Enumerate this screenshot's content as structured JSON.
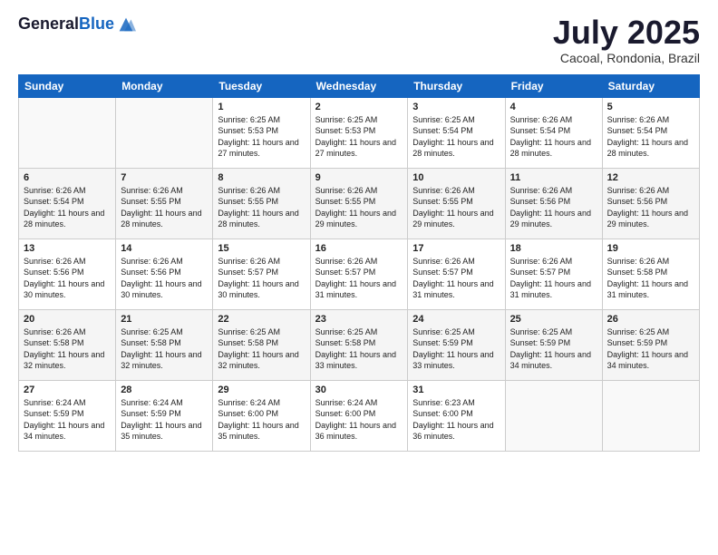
{
  "logo": {
    "general": "General",
    "blue": "Blue"
  },
  "header": {
    "month": "July 2025",
    "location": "Cacoal, Rondonia, Brazil"
  },
  "weekdays": [
    "Sunday",
    "Monday",
    "Tuesday",
    "Wednesday",
    "Thursday",
    "Friday",
    "Saturday"
  ],
  "weeks": [
    [
      {
        "day": "",
        "sunrise": "",
        "sunset": "",
        "daylight": ""
      },
      {
        "day": "",
        "sunrise": "",
        "sunset": "",
        "daylight": ""
      },
      {
        "day": "1",
        "sunrise": "Sunrise: 6:25 AM",
        "sunset": "Sunset: 5:53 PM",
        "daylight": "Daylight: 11 hours and 27 minutes."
      },
      {
        "day": "2",
        "sunrise": "Sunrise: 6:25 AM",
        "sunset": "Sunset: 5:53 PM",
        "daylight": "Daylight: 11 hours and 27 minutes."
      },
      {
        "day": "3",
        "sunrise": "Sunrise: 6:25 AM",
        "sunset": "Sunset: 5:54 PM",
        "daylight": "Daylight: 11 hours and 28 minutes."
      },
      {
        "day": "4",
        "sunrise": "Sunrise: 6:26 AM",
        "sunset": "Sunset: 5:54 PM",
        "daylight": "Daylight: 11 hours and 28 minutes."
      },
      {
        "day": "5",
        "sunrise": "Sunrise: 6:26 AM",
        "sunset": "Sunset: 5:54 PM",
        "daylight": "Daylight: 11 hours and 28 minutes."
      }
    ],
    [
      {
        "day": "6",
        "sunrise": "Sunrise: 6:26 AM",
        "sunset": "Sunset: 5:54 PM",
        "daylight": "Daylight: 11 hours and 28 minutes."
      },
      {
        "day": "7",
        "sunrise": "Sunrise: 6:26 AM",
        "sunset": "Sunset: 5:55 PM",
        "daylight": "Daylight: 11 hours and 28 minutes."
      },
      {
        "day": "8",
        "sunrise": "Sunrise: 6:26 AM",
        "sunset": "Sunset: 5:55 PM",
        "daylight": "Daylight: 11 hours and 28 minutes."
      },
      {
        "day": "9",
        "sunrise": "Sunrise: 6:26 AM",
        "sunset": "Sunset: 5:55 PM",
        "daylight": "Daylight: 11 hours and 29 minutes."
      },
      {
        "day": "10",
        "sunrise": "Sunrise: 6:26 AM",
        "sunset": "Sunset: 5:55 PM",
        "daylight": "Daylight: 11 hours and 29 minutes."
      },
      {
        "day": "11",
        "sunrise": "Sunrise: 6:26 AM",
        "sunset": "Sunset: 5:56 PM",
        "daylight": "Daylight: 11 hours and 29 minutes."
      },
      {
        "day": "12",
        "sunrise": "Sunrise: 6:26 AM",
        "sunset": "Sunset: 5:56 PM",
        "daylight": "Daylight: 11 hours and 29 minutes."
      }
    ],
    [
      {
        "day": "13",
        "sunrise": "Sunrise: 6:26 AM",
        "sunset": "Sunset: 5:56 PM",
        "daylight": "Daylight: 11 hours and 30 minutes."
      },
      {
        "day": "14",
        "sunrise": "Sunrise: 6:26 AM",
        "sunset": "Sunset: 5:56 PM",
        "daylight": "Daylight: 11 hours and 30 minutes."
      },
      {
        "day": "15",
        "sunrise": "Sunrise: 6:26 AM",
        "sunset": "Sunset: 5:57 PM",
        "daylight": "Daylight: 11 hours and 30 minutes."
      },
      {
        "day": "16",
        "sunrise": "Sunrise: 6:26 AM",
        "sunset": "Sunset: 5:57 PM",
        "daylight": "Daylight: 11 hours and 31 minutes."
      },
      {
        "day": "17",
        "sunrise": "Sunrise: 6:26 AM",
        "sunset": "Sunset: 5:57 PM",
        "daylight": "Daylight: 11 hours and 31 minutes."
      },
      {
        "day": "18",
        "sunrise": "Sunrise: 6:26 AM",
        "sunset": "Sunset: 5:57 PM",
        "daylight": "Daylight: 11 hours and 31 minutes."
      },
      {
        "day": "19",
        "sunrise": "Sunrise: 6:26 AM",
        "sunset": "Sunset: 5:58 PM",
        "daylight": "Daylight: 11 hours and 31 minutes."
      }
    ],
    [
      {
        "day": "20",
        "sunrise": "Sunrise: 6:26 AM",
        "sunset": "Sunset: 5:58 PM",
        "daylight": "Daylight: 11 hours and 32 minutes."
      },
      {
        "day": "21",
        "sunrise": "Sunrise: 6:25 AM",
        "sunset": "Sunset: 5:58 PM",
        "daylight": "Daylight: 11 hours and 32 minutes."
      },
      {
        "day": "22",
        "sunrise": "Sunrise: 6:25 AM",
        "sunset": "Sunset: 5:58 PM",
        "daylight": "Daylight: 11 hours and 32 minutes."
      },
      {
        "day": "23",
        "sunrise": "Sunrise: 6:25 AM",
        "sunset": "Sunset: 5:58 PM",
        "daylight": "Daylight: 11 hours and 33 minutes."
      },
      {
        "day": "24",
        "sunrise": "Sunrise: 6:25 AM",
        "sunset": "Sunset: 5:59 PM",
        "daylight": "Daylight: 11 hours and 33 minutes."
      },
      {
        "day": "25",
        "sunrise": "Sunrise: 6:25 AM",
        "sunset": "Sunset: 5:59 PM",
        "daylight": "Daylight: 11 hours and 34 minutes."
      },
      {
        "day": "26",
        "sunrise": "Sunrise: 6:25 AM",
        "sunset": "Sunset: 5:59 PM",
        "daylight": "Daylight: 11 hours and 34 minutes."
      }
    ],
    [
      {
        "day": "27",
        "sunrise": "Sunrise: 6:24 AM",
        "sunset": "Sunset: 5:59 PM",
        "daylight": "Daylight: 11 hours and 34 minutes."
      },
      {
        "day": "28",
        "sunrise": "Sunrise: 6:24 AM",
        "sunset": "Sunset: 5:59 PM",
        "daylight": "Daylight: 11 hours and 35 minutes."
      },
      {
        "day": "29",
        "sunrise": "Sunrise: 6:24 AM",
        "sunset": "Sunset: 6:00 PM",
        "daylight": "Daylight: 11 hours and 35 minutes."
      },
      {
        "day": "30",
        "sunrise": "Sunrise: 6:24 AM",
        "sunset": "Sunset: 6:00 PM",
        "daylight": "Daylight: 11 hours and 36 minutes."
      },
      {
        "day": "31",
        "sunrise": "Sunrise: 6:23 AM",
        "sunset": "Sunset: 6:00 PM",
        "daylight": "Daylight: 11 hours and 36 minutes."
      },
      {
        "day": "",
        "sunrise": "",
        "sunset": "",
        "daylight": ""
      },
      {
        "day": "",
        "sunrise": "",
        "sunset": "",
        "daylight": ""
      }
    ]
  ]
}
